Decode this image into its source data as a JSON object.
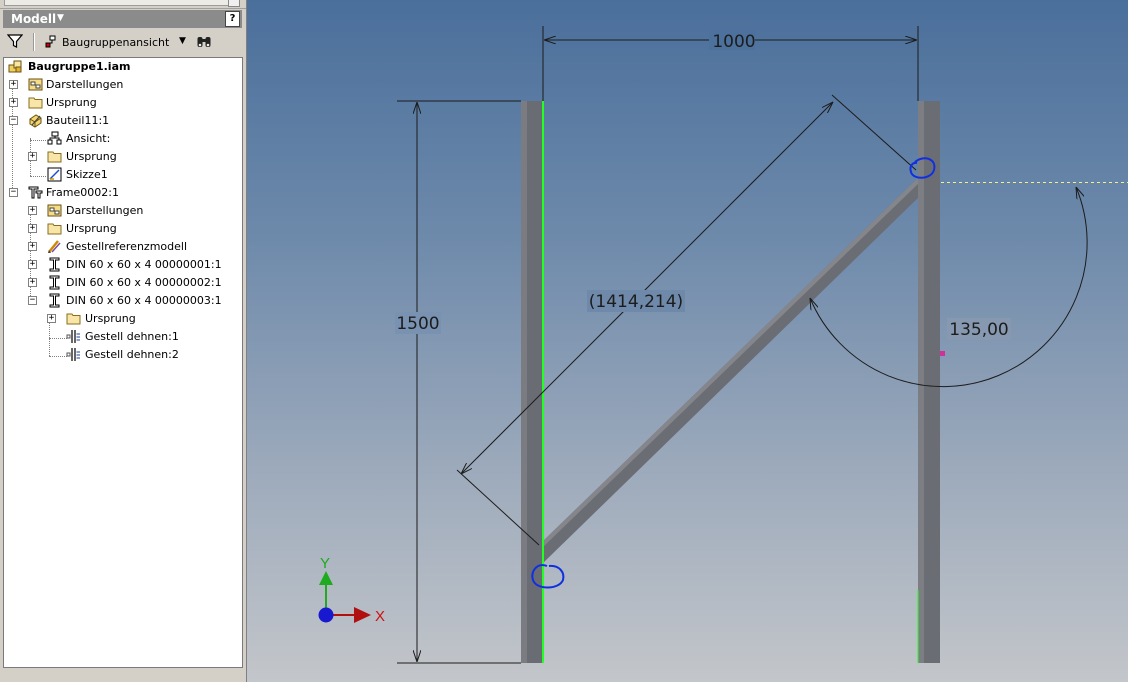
{
  "browser": {
    "title": "Modell",
    "help_label": "?",
    "view_dropdown": "Baugruppenansicht",
    "tree": [
      {
        "label": "Baugruppe1.iam",
        "icon": "assembly-icon",
        "expander": "",
        "bold": true
      },
      {
        "label": "Darstellungen",
        "icon": "representations-icon",
        "expander": "+"
      },
      {
        "label": "Ursprung",
        "icon": "folder-icon",
        "expander": "+"
      },
      {
        "label": "Bauteil11:1",
        "icon": "part-icon",
        "expander": "−"
      },
      {
        "label": "Ansicht:",
        "icon": "view-icon",
        "expander": ""
      },
      {
        "label": "Ursprung",
        "icon": "folder-icon",
        "expander": "+"
      },
      {
        "label": "Skizze1",
        "icon": "sketch-icon",
        "expander": ""
      },
      {
        "label": "Frame0002:1",
        "icon": "frame-icon",
        "expander": "−"
      },
      {
        "label": "Darstellungen",
        "icon": "representations-icon",
        "expander": "+"
      },
      {
        "label": "Ursprung",
        "icon": "folder-icon",
        "expander": "+"
      },
      {
        "label": "Gestellreferenzmodell",
        "icon": "frame-reference-icon",
        "expander": "+"
      },
      {
        "label": "DIN 60 x 60 x 4 00000001:1",
        "icon": "i-beam-icon",
        "expander": "+"
      },
      {
        "label": "DIN 60 x 60 x 4 00000002:1",
        "icon": "i-beam-icon",
        "expander": "+"
      },
      {
        "label": "DIN 60 x 60 x 4 00000003:1",
        "icon": "i-beam-icon",
        "expander": "−"
      },
      {
        "label": "Ursprung",
        "icon": "folder-icon",
        "expander": "+"
      },
      {
        "label": "Gestell dehnen:1",
        "icon": "frame-extend-icon",
        "expander": ""
      },
      {
        "label": "Gestell dehnen:2",
        "icon": "frame-extend-icon",
        "expander": ""
      }
    ]
  },
  "viewport": {
    "dim_width": "1000",
    "dim_height": "1500",
    "dim_diagonal": "(1414,214)",
    "dim_angle": "135,00",
    "triad": {
      "y_label": "Y",
      "x_label": "X"
    },
    "colors": {
      "frame_member": "#6b6d74",
      "highlight_edge": "#22ff22",
      "reference_line": "#f5f08a",
      "annotation": "#1030e0",
      "triad_y": "#1faa1f",
      "triad_x": "#b01010",
      "triad_origin": "#1818d0",
      "marker": "#d0309a"
    }
  }
}
